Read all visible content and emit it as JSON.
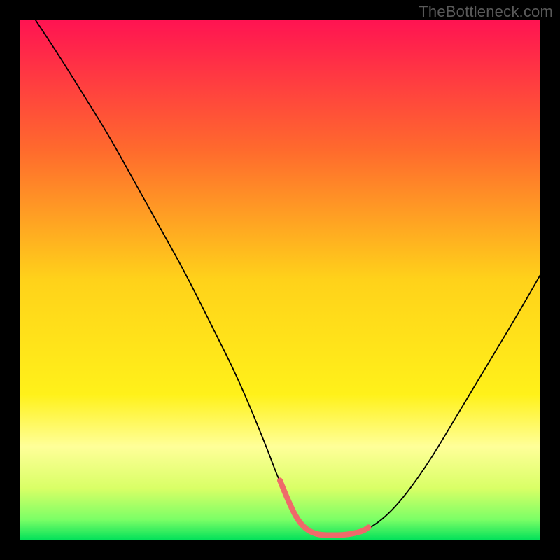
{
  "watermark": "TheBottleneck.com",
  "chart_data": {
    "type": "line",
    "title": "",
    "xlabel": "",
    "ylabel": "",
    "xlim": [
      0,
      100
    ],
    "ylim": [
      0,
      100
    ],
    "grid": false,
    "legend": false,
    "background_gradient_stops": [
      {
        "offset": 0.0,
        "color": "#ff1352"
      },
      {
        "offset": 0.25,
        "color": "#ff6a2d"
      },
      {
        "offset": 0.5,
        "color": "#ffd21a"
      },
      {
        "offset": 0.72,
        "color": "#fff11a"
      },
      {
        "offset": 0.82,
        "color": "#ffff99"
      },
      {
        "offset": 0.9,
        "color": "#d9ff66"
      },
      {
        "offset": 0.96,
        "color": "#7bff66"
      },
      {
        "offset": 1.0,
        "color": "#00e05a"
      }
    ],
    "series": [
      {
        "name": "bottleneck-curve",
        "color": "#000000",
        "width": 1.8,
        "x": [
          3,
          7,
          12,
          17,
          22,
          27,
          32,
          37,
          42,
          47,
          50,
          53,
          55,
          57,
          60,
          63,
          67,
          72,
          78,
          84,
          90,
          96,
          100
        ],
        "y": [
          100,
          94,
          86,
          78,
          69,
          60,
          51,
          41,
          31,
          19,
          11,
          5,
          2,
          1,
          1,
          1,
          2,
          6,
          14,
          24,
          34,
          44,
          51
        ]
      },
      {
        "name": "optimal-band",
        "color": "#ef6a6a",
        "width": 8,
        "x": [
          50,
          52,
          54,
          56,
          58,
          60,
          62,
          64,
          66,
          67
        ],
        "y": [
          11.5,
          6.5,
          3.0,
          1.5,
          1.0,
          1.0,
          1.0,
          1.3,
          1.8,
          2.5
        ]
      }
    ]
  }
}
